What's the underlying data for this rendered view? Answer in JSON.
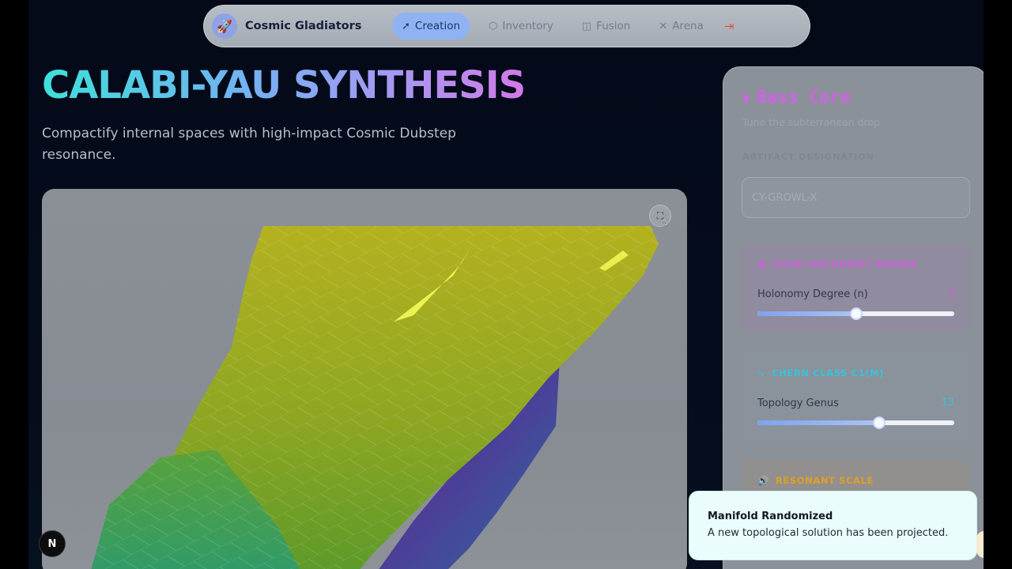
{
  "nav": {
    "brand": "Cosmic Gladiators",
    "brand_icon": "rocket-icon",
    "items": [
      {
        "label": "Creation",
        "icon": "rocket-icon",
        "active": true
      },
      {
        "label": "Inventory",
        "icon": "cube-icon",
        "active": false
      },
      {
        "label": "Fusion",
        "icon": "layers-icon",
        "active": false
      },
      {
        "label": "Arena",
        "icon": "crossed-swords-icon",
        "active": false
      }
    ],
    "logout_icon": "logout-icon"
  },
  "hero": {
    "title": "CALABI-YAU SYNTHESIS",
    "subtitle": "Compactify internal spaces with high-impact Cosmic Dubstep resonance."
  },
  "viewport": {
    "fullscreen_icon": "fullscreen-icon"
  },
  "next_badge": "N",
  "panel": {
    "title": "Bass Core",
    "title_icon": "lightning-icon",
    "subtitle": "Tune the subterranean drop",
    "field_label": "ARTIFACT DESIGNATION",
    "field_value": "CY-GROWL-X",
    "sections": {
      "holonomy": {
        "title": "SU(N) HOLONOMY ENGINE",
        "icon": "chip-icon",
        "param": "Holonomy Degree (n)",
        "value": "5",
        "fraction": 0.5
      },
      "chern": {
        "title": "CHERN CLASS C1(M)",
        "icon": "pulse-icon",
        "param": "Topology Genus",
        "value": "13",
        "fraction": 0.62
      },
      "resonant": {
        "title": "RESONANT SCALE",
        "icon": "speaker-icon"
      }
    }
  },
  "toast": {
    "title": "Manifold Randomized",
    "body": "A new topological solution has been projected."
  },
  "colors": {
    "accent_magenta": "#cf63e6",
    "accent_cyan": "#38c3da",
    "accent_amber": "#e0a021",
    "active_tab": "#8fb3f2"
  }
}
